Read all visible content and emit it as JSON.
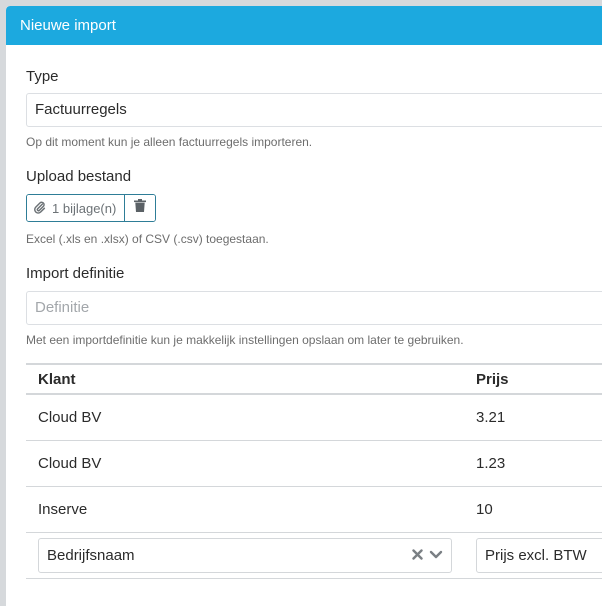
{
  "modal": {
    "title": "Nieuwe import"
  },
  "type_section": {
    "label": "Type",
    "value": "Factuurregels",
    "help": "Op dit moment kun je alleen factuurregels importeren."
  },
  "upload_section": {
    "label": "Upload bestand",
    "attachment_label": "1 bijlage(n)",
    "help": "Excel (.xls en .xlsx) of CSV (.csv) toegestaan."
  },
  "definition_section": {
    "label": "Import definitie",
    "placeholder": "Definitie",
    "help": "Met een importdefinitie kun je makkelijk instellingen opslaan om later te gebruiken."
  },
  "preview_table": {
    "columns": [
      "Klant",
      "Prijs"
    ],
    "rows": [
      [
        "Cloud BV",
        "3.21"
      ],
      [
        "Cloud BV",
        "1.23"
      ],
      [
        "Inserve",
        "10"
      ]
    ],
    "mapping": {
      "klant": "Bedrijfsnaam",
      "prijs": "Prijs excl. BTW"
    }
  },
  "colors": {
    "header": "#1ca9df",
    "border_accent": "#2e7d97"
  },
  "icons": {
    "attachment": "paperclip-icon",
    "delete": "trash-icon",
    "clear": "clear-x-icon",
    "dropdown": "chevron-down-icon"
  }
}
